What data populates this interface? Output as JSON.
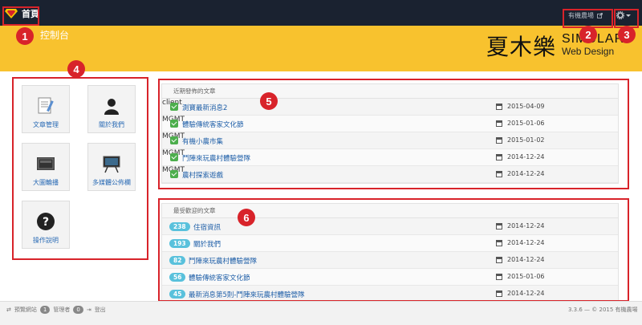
{
  "nav": {
    "home_label": "首頁",
    "farm_link": "有機農場",
    "settings_icon": "gear-icon"
  },
  "banner": {
    "title": "控制台",
    "brand_zh": "夏木樂",
    "brand_en": "SIMULAR",
    "brand_sub": "Web Design"
  },
  "annotations": [
    "1",
    "2",
    "3",
    "4",
    "5",
    "6"
  ],
  "shortcuts": [
    {
      "label": "文章管理",
      "icon": "document-icon"
    },
    {
      "label": "關於我們",
      "icon": "person-icon"
    },
    {
      "label": "大圖輪播",
      "icon": "slideshow-icon"
    },
    {
      "label": "多媒體公佈欄",
      "icon": "board-icon"
    },
    {
      "label": "操作說明",
      "icon": "help-icon"
    }
  ],
  "recent": {
    "heading": "近期發佈的文章",
    "items": [
      {
        "title": "測寶最新消息2",
        "tag": "client",
        "date": "2015-04-09"
      },
      {
        "title": "體驗傳統客家文化節",
        "tag": "MGMT",
        "date": "2015-01-06"
      },
      {
        "title": "有機小農市集",
        "tag": "MGMT",
        "date": "2015-01-02"
      },
      {
        "title": "鬥陣來玩農村體驗營隊",
        "tag": "MGMT",
        "date": "2014-12-24"
      },
      {
        "title": "農村探索遊戲",
        "tag": "MGMT",
        "date": "2014-12-24"
      }
    ]
  },
  "popular": {
    "heading": "最受歡迎的文章",
    "items": [
      {
        "count": "238",
        "title": "住宿資訊",
        "date": "2014-12-24"
      },
      {
        "count": "193",
        "title": "關於我們",
        "date": "2014-12-24"
      },
      {
        "count": "82",
        "title": "鬥陣來玩農村體驗營隊",
        "date": "2014-12-24"
      },
      {
        "count": "56",
        "title": "體驗傳統客家文化節",
        "date": "2015-01-06"
      },
      {
        "count": "45",
        "title": "最新消息第5則-鬥陣來玩農村體驗營隊",
        "date": "2014-12-24"
      }
    ]
  },
  "footer": {
    "preview": "預覽網站",
    "admin_count": "1",
    "admin_label": "管理者",
    "online_count": "0",
    "logout": "登出",
    "version": "3.3.6",
    "copyright": "— © 2015 有機農場"
  },
  "colors": {
    "topbar": "#1a2230",
    "banner": "#f8c22e",
    "annotation": "#d8232a",
    "link": "#1f5fa8",
    "count_badge": "#59c1dc",
    "check": "#4cae4c"
  }
}
